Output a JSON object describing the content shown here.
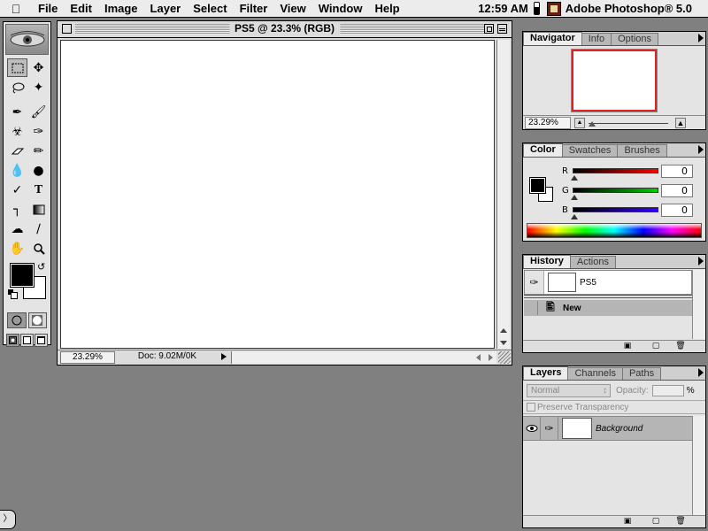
{
  "menubar": {
    "items": [
      "File",
      "Edit",
      "Image",
      "Layer",
      "Select",
      "Filter",
      "View",
      "Window",
      "Help"
    ],
    "clock": "12:59 AM",
    "app_name": "Adobe Photoshop® 5.0"
  },
  "document": {
    "title": "PS5 @ 23.3% (RGB)",
    "zoom": "23.29%",
    "doc_info": "Doc: 9.02M/0K"
  },
  "navigator": {
    "tabs": [
      "Navigator",
      "Info",
      "Options"
    ],
    "zoom": "23.29%",
    "accent": "#dd2222"
  },
  "color": {
    "tabs": [
      "Color",
      "Swatches",
      "Brushes"
    ],
    "channels": [
      {
        "label": "R",
        "value": "0",
        "gradient": "#ff0000"
      },
      {
        "label": "G",
        "value": "0",
        "gradient": "#00cc00"
      },
      {
        "label": "B",
        "value": "0",
        "gradient": "#3300ff"
      }
    ]
  },
  "history": {
    "tabs": [
      "History",
      "Actions"
    ],
    "snapshot_name": "PS5",
    "states": [
      "New"
    ]
  },
  "layers": {
    "tabs": [
      "Layers",
      "Channels",
      "Paths"
    ],
    "blend_mode": "Normal",
    "opacity_label": "Opacity:",
    "opacity_unit": "%",
    "preserve_transparency": "Preserve Transparency",
    "items": [
      "Background"
    ]
  },
  "tools": [
    "marquee-tool",
    "move-tool",
    "lasso-tool",
    "magic-wand-tool",
    "airbrush-tool",
    "paintbrush-tool",
    "rubber-stamp-tool",
    "history-brush-tool",
    "eraser-tool",
    "pencil-tool",
    "blur-tool",
    "dodge-tool",
    "pen-tool",
    "type-tool",
    "measure-tool",
    "gradient-tool",
    "paint-bucket-tool",
    "eyedropper-tool",
    "hand-tool",
    "zoom-tool"
  ]
}
